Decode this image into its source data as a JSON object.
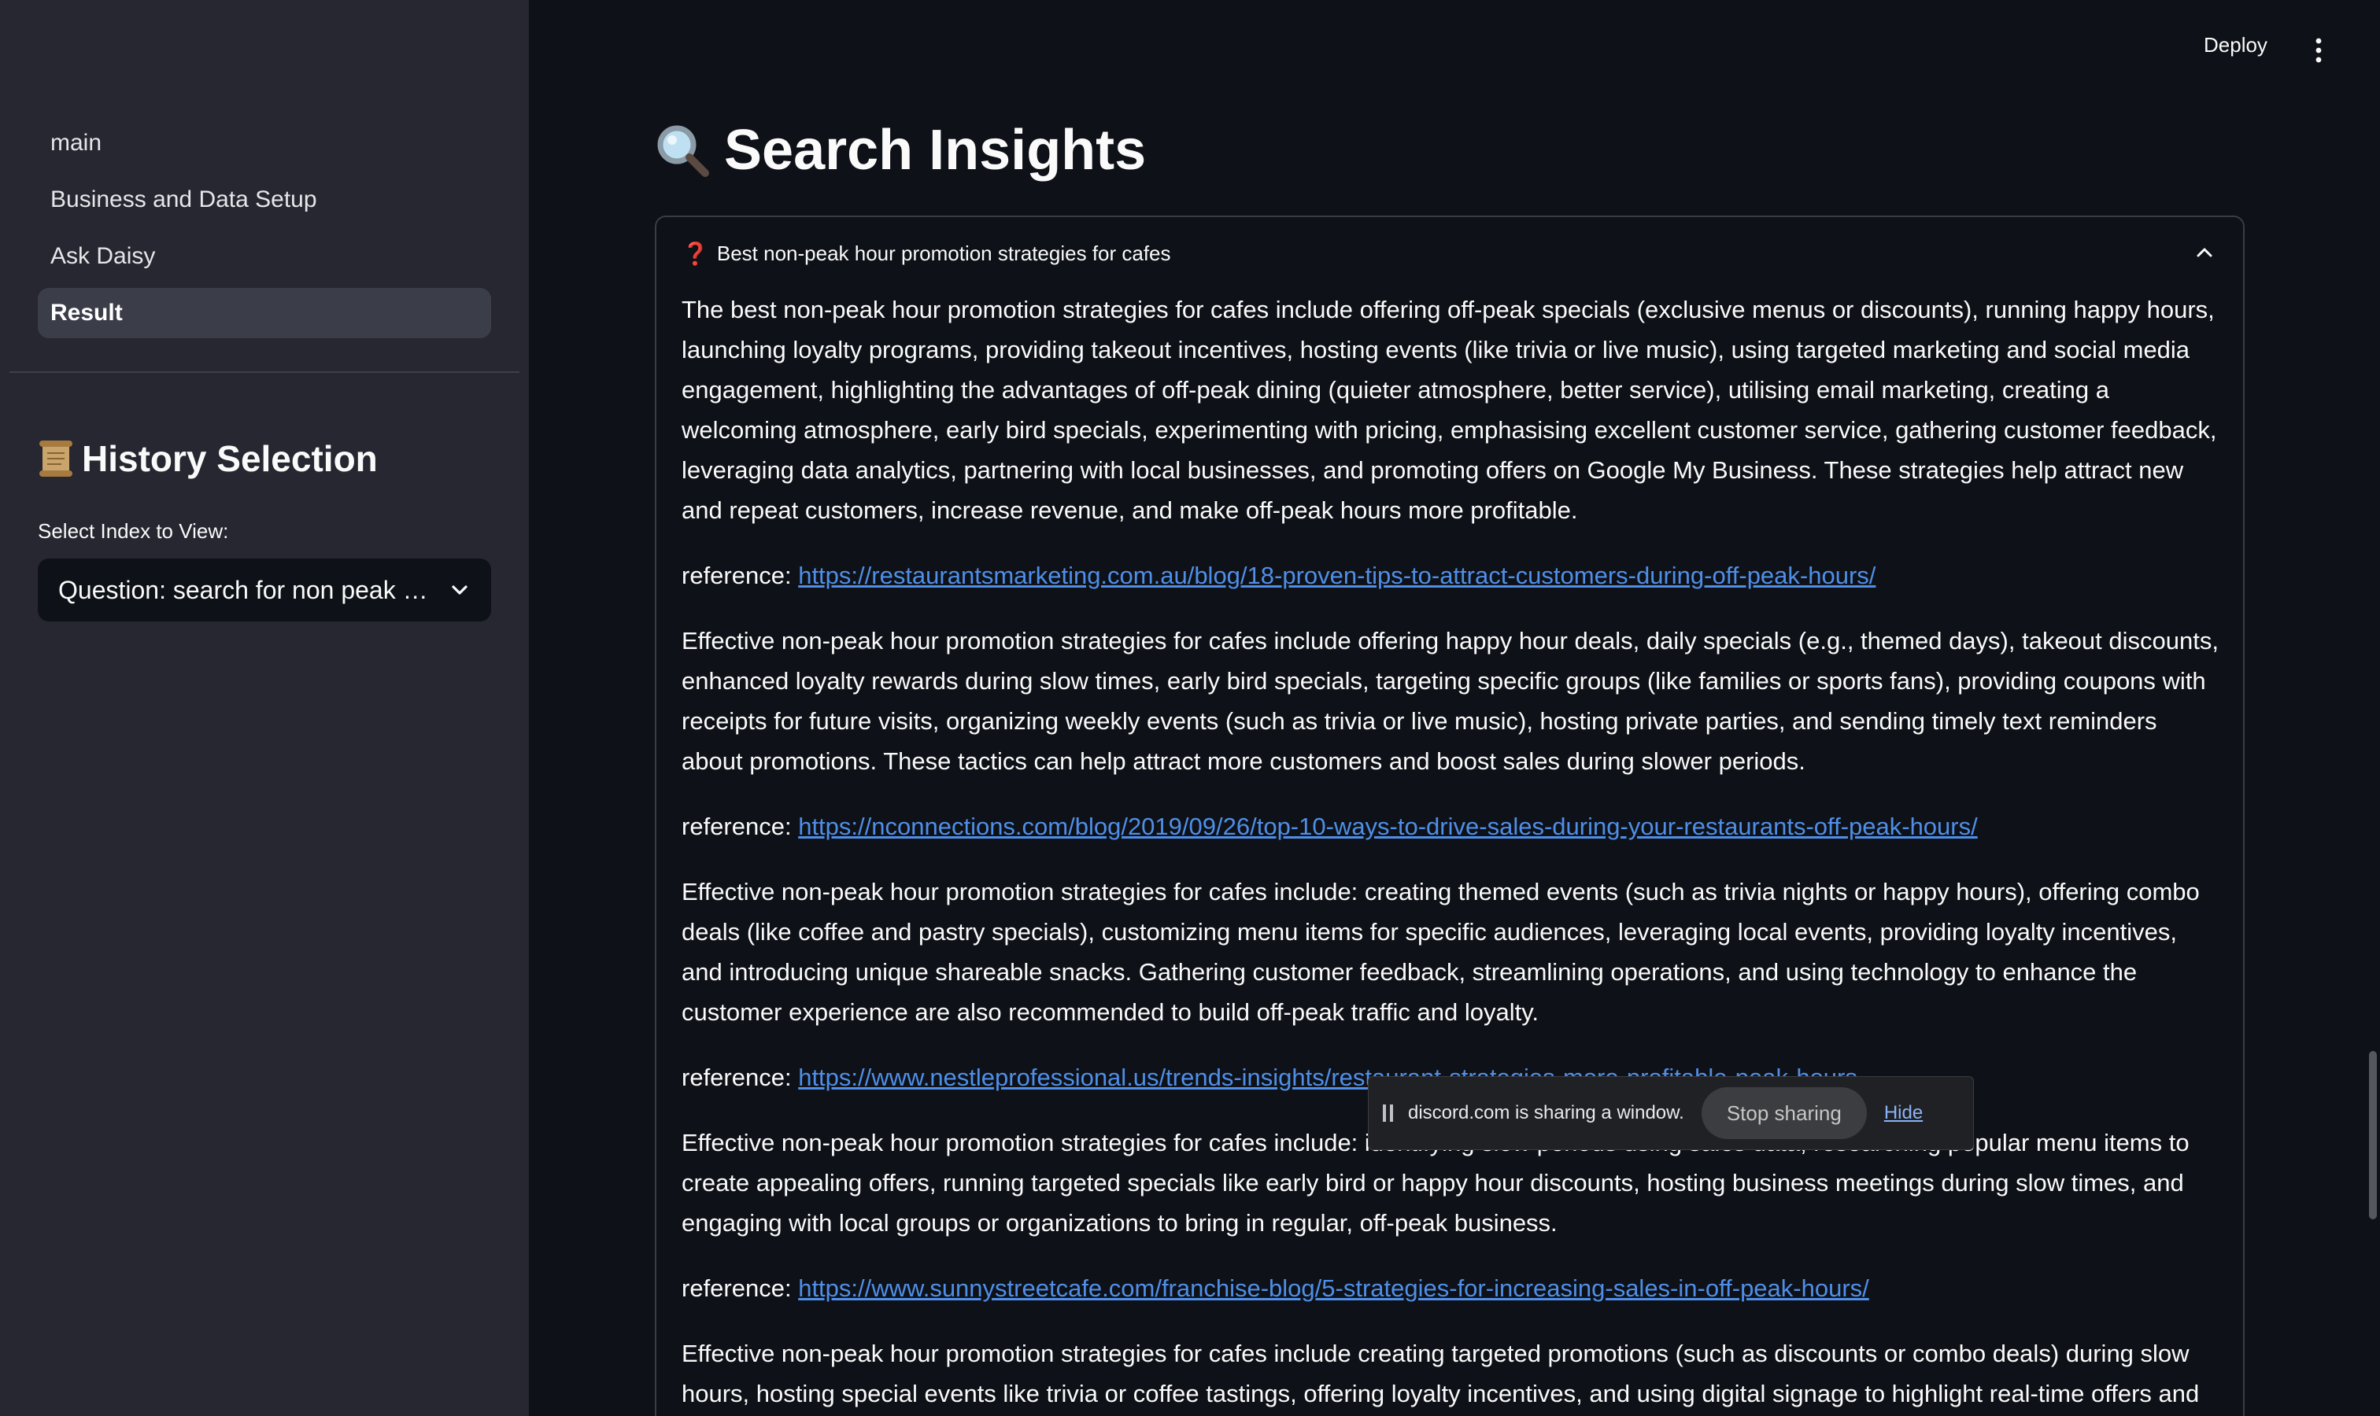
{
  "topbar": {
    "deploy_label": "Deploy",
    "menu_icon": "kebab-menu-icon"
  },
  "sidebar": {
    "nav": [
      {
        "label": "main",
        "active": false
      },
      {
        "label": "Business and Data Setup",
        "active": false
      },
      {
        "label": "Ask Daisy",
        "active": false
      },
      {
        "label": "Result",
        "active": true
      }
    ],
    "history": {
      "icon": "scroll-icon",
      "title": "History Selection",
      "select_label": "Select Index to View:",
      "selected_value": "Question: search for non peak hour promotion strategies for cafes"
    }
  },
  "main": {
    "title_icon": "magnifying-glass-icon",
    "title": "Search Insights",
    "expander": {
      "icon": "red-question-mark-icon",
      "question": "Best non-peak hour promotion strategies for cafes",
      "reference_prefix": "reference:",
      "results": [
        {
          "text": "The best non-peak hour promotion strategies for cafes include offering off-peak specials (exclusive menus or discounts), running happy hours, launching loyalty programs, providing takeout incentives, hosting events (like trivia or live music), using targeted marketing and social media engagement, highlighting the advantages of off-peak dining (quieter atmosphere, better service), utilising email marketing, creating a welcoming atmosphere, early bird specials, experimenting with pricing, emphasising excellent customer service, gathering customer feedback, leveraging data analytics, partnering with local businesses, and promoting offers on Google My Business. These strategies help attract new and repeat customers, increase revenue, and make off-peak hours more profitable.",
          "url": "https://restaurantsmarketing.com.au/blog/18-proven-tips-to-attract-customers-during-off-peak-hours/"
        },
        {
          "text": "Effective non-peak hour promotion strategies for cafes include offering happy hour deals, daily specials (e.g., themed days), takeout discounts, enhanced loyalty rewards during slow times, early bird specials, targeting specific groups (like families or sports fans), providing coupons with receipts for future visits, organizing weekly events (such as trivia or live music), hosting private parties, and sending timely text reminders about promotions. These tactics can help attract more customers and boost sales during slower periods.",
          "url": "https://nconnections.com/blog/2019/09/26/top-10-ways-to-drive-sales-during-your-restaurants-off-peak-hours/"
        },
        {
          "text": "Effective non-peak hour promotion strategies for cafes include: creating themed events (such as trivia nights or happy hours), offering combo deals (like coffee and pastry specials), customizing menu items for specific audiences, leveraging local events, providing loyalty incentives, and introducing unique shareable snacks. Gathering customer feedback, streamlining operations, and using technology to enhance the customer experience are also recommended to build off-peak traffic and loyalty.",
          "url": "https://www.nestleprofessional.us/trends-insights/restaurant-strategies-more-profitable-peak-hours"
        },
        {
          "text": "Effective non-peak hour promotion strategies for cafes include: identifying slow periods using sales data, researching popular menu items to create appealing offers, running targeted specials like early bird or happy hour discounts, hosting business meetings during slow times, and engaging with local groups or organizations to bring in regular, off-peak business.",
          "url": "https://www.sunnystreetcafe.com/franchise-blog/5-strategies-for-increasing-sales-in-off-peak-hours/"
        },
        {
          "text": "Effective non-peak hour promotion strategies for cafes include creating targeted promotions (such as discounts or combo deals) during slow hours, hosting special events like trivia or coffee tastings, offering loyalty incentives, and using digital signage to highlight real-time offers and specials.",
          "url": ""
        }
      ]
    }
  },
  "sharebar": {
    "message": "discord.com is sharing a window.",
    "stop_label": "Stop sharing",
    "hide_label": "Hide"
  },
  "colors": {
    "sidebar_bg": "#262730",
    "main_bg": "#0e1117",
    "link": "#4f8fe8",
    "active_nav_bg": "#3b3d48",
    "question_mark": "#e0322c"
  }
}
